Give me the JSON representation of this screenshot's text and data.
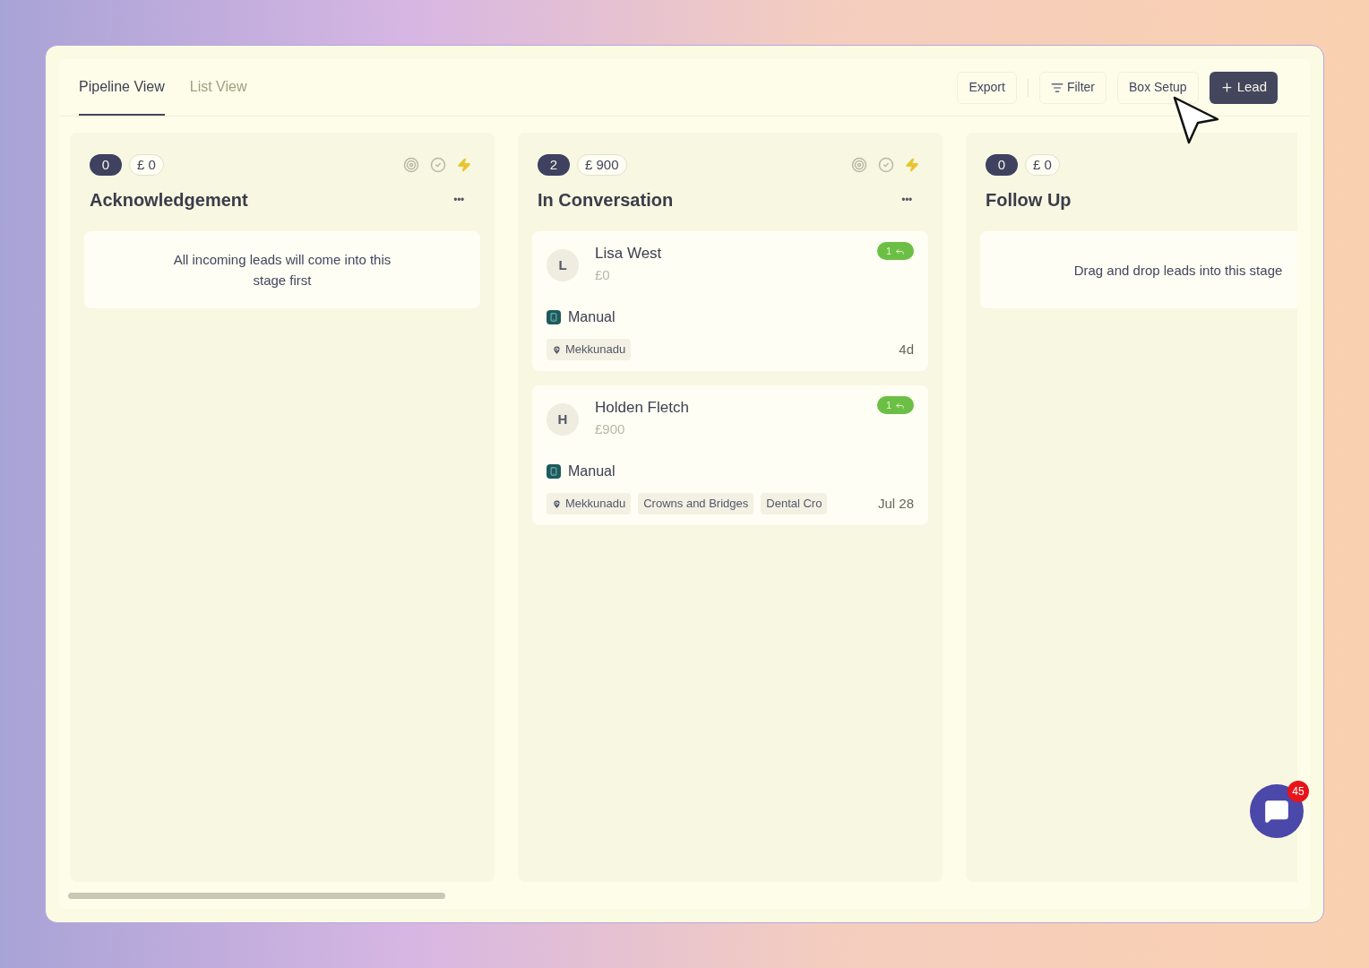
{
  "tabs": [
    {
      "label": "Pipeline View",
      "selected": true
    },
    {
      "label": "List View",
      "selected": false
    }
  ],
  "actions": [
    {
      "label": "Export",
      "kind": "plain"
    },
    {
      "label": "Filter",
      "kind": "filter"
    },
    {
      "label": "Box Setup",
      "kind": "plain"
    },
    {
      "label": "Lead",
      "kind": "primary"
    }
  ],
  "columns": [
    {
      "count": "0",
      "amount": "£ 0",
      "title": "Acknowledgement",
      "menu": "•••",
      "empty_text": "All incoming leads will come into this stage first"
    },
    {
      "count": "2",
      "amount": "£ 900",
      "title": "In Conversation",
      "menu": "•••",
      "leads": [
        {
          "initial": "L",
          "name": "Lisa West",
          "amount": "£0",
          "badge": "1",
          "source": "Manual",
          "tags": [
            {
              "label": "Mekkunadu",
              "kind": "location"
            }
          ],
          "age": "4d"
        },
        {
          "initial": "H",
          "name": "Holden Fletch",
          "amount": "£900",
          "badge": "1",
          "source": "Manual",
          "tags": [
            {
              "label": "Mekkunadu",
              "kind": "location"
            },
            {
              "label": "Crowns and Bridges",
              "kind": "plain"
            },
            {
              "label": "Dental Cro",
              "kind": "plain"
            }
          ],
          "age": "Jul 28"
        }
      ]
    },
    {
      "count": "0",
      "amount": "£ 0",
      "title": "Follow Up",
      "empty_text": "Drag and drop leads into this stage"
    }
  ],
  "chat": {
    "badge": "45"
  }
}
